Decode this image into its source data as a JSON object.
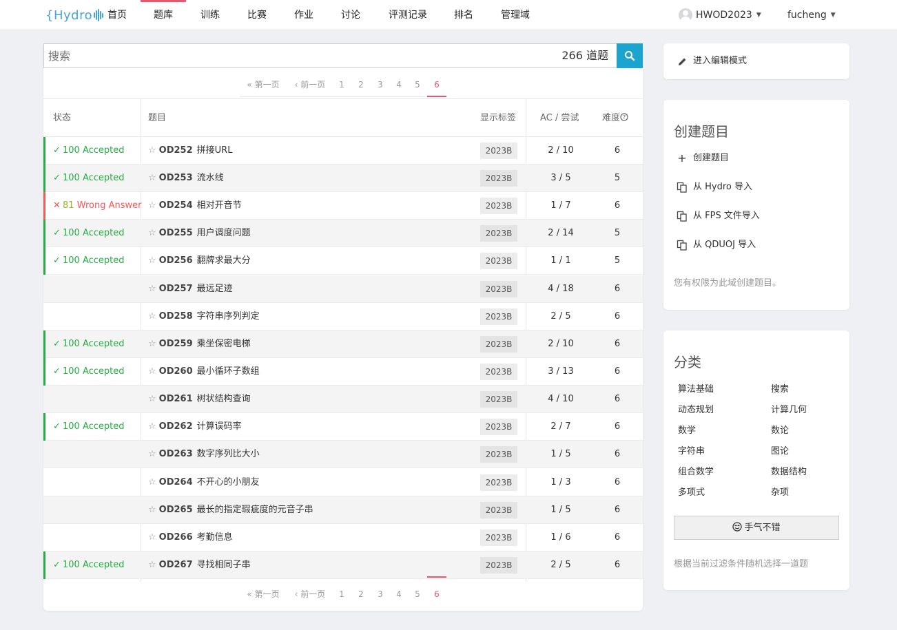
{
  "nav": {
    "logo": "{Hydro",
    "items": [
      "首页",
      "题库",
      "训练",
      "比赛",
      "作业",
      "讨论",
      "评测记录",
      "排名",
      "管理域"
    ],
    "active_index": 1,
    "domain": "HWOD2023",
    "user": "fucheng"
  },
  "search": {
    "placeholder": "搜索",
    "count": "266 道题"
  },
  "pagination": {
    "first": "« 第一页",
    "prev": "‹ 前一页",
    "pages": [
      "1",
      "2",
      "3",
      "4",
      "5",
      "6"
    ],
    "current": "6"
  },
  "table": {
    "headers": {
      "status": "状态",
      "title": "题目",
      "tags": "显示标签",
      "ac": "AC / 尝试",
      "difficulty": "难度"
    },
    "rows": [
      {
        "status": "ac",
        "score": "100",
        "status_text": "Accepted",
        "pid": "OD252",
        "name": "拼接URL",
        "tag": "2023B",
        "ac": "2 / 10",
        "diff": "6"
      },
      {
        "status": "ac",
        "score": "100",
        "status_text": "Accepted",
        "pid": "OD253",
        "name": "流水线",
        "tag": "2023B",
        "ac": "3 / 5",
        "diff": "5"
      },
      {
        "status": "wa",
        "score": "81",
        "status_text": "Wrong Answer",
        "pid": "OD254",
        "name": "相对开音节",
        "tag": "2023B",
        "ac": "1 / 7",
        "diff": "6"
      },
      {
        "status": "ac",
        "score": "100",
        "status_text": "Accepted",
        "pid": "OD255",
        "name": "用户调度问题",
        "tag": "2023B",
        "ac": "2 / 14",
        "diff": "5"
      },
      {
        "status": "ac",
        "score": "100",
        "status_text": "Accepted",
        "pid": "OD256",
        "name": "翻牌求最大分",
        "tag": "2023B",
        "ac": "1 / 1",
        "diff": "5"
      },
      {
        "status": "",
        "score": "",
        "status_text": "",
        "pid": "OD257",
        "name": "最远足迹",
        "tag": "2023B",
        "ac": "4 / 18",
        "diff": "6"
      },
      {
        "status": "",
        "score": "",
        "status_text": "",
        "pid": "OD258",
        "name": "字符串序列判定",
        "tag": "2023B",
        "ac": "2 / 5",
        "diff": "6"
      },
      {
        "status": "ac",
        "score": "100",
        "status_text": "Accepted",
        "pid": "OD259",
        "name": "乘坐保密电梯",
        "tag": "2023B",
        "ac": "2 / 10",
        "diff": "6"
      },
      {
        "status": "ac",
        "score": "100",
        "status_text": "Accepted",
        "pid": "OD260",
        "name": "最小循环子数组",
        "tag": "2023B",
        "ac": "3 / 13",
        "diff": "6"
      },
      {
        "status": "",
        "score": "",
        "status_text": "",
        "pid": "OD261",
        "name": "树状结构查询",
        "tag": "2023B",
        "ac": "4 / 10",
        "diff": "6"
      },
      {
        "status": "ac",
        "score": "100",
        "status_text": "Accepted",
        "pid": "OD262",
        "name": "计算误码率",
        "tag": "2023B",
        "ac": "2 / 7",
        "diff": "6"
      },
      {
        "status": "",
        "score": "",
        "status_text": "",
        "pid": "OD263",
        "name": "数字序列比大小",
        "tag": "2023B",
        "ac": "1 / 5",
        "diff": "6"
      },
      {
        "status": "",
        "score": "",
        "status_text": "",
        "pid": "OD264",
        "name": "不开心的小朋友",
        "tag": "2023B",
        "ac": "1 / 3",
        "diff": "6"
      },
      {
        "status": "",
        "score": "",
        "status_text": "",
        "pid": "OD265",
        "name": "最长的指定瑕疵度的元音子串",
        "tag": "2023B",
        "ac": "1 / 5",
        "diff": "6"
      },
      {
        "status": "",
        "score": "",
        "status_text": "",
        "pid": "OD266",
        "name": "考勤信息",
        "tag": "2023B",
        "ac": "1 / 6",
        "diff": "6"
      },
      {
        "status": "ac",
        "score": "100",
        "status_text": "Accepted",
        "pid": "OD267",
        "name": "寻找相同子串",
        "tag": "2023B",
        "ac": "2 / 5",
        "diff": "6"
      }
    ]
  },
  "sidebar": {
    "edit_mode": "进入编辑模式",
    "create": {
      "heading": "创建题目",
      "links": [
        "创建题目",
        "从 Hydro 导入",
        "从 FPS 文件导入",
        "从 QDUOJ 导入"
      ],
      "note": "您有权限为此域创建题目。"
    },
    "categories": {
      "heading": "分类",
      "items": [
        "算法基础",
        "搜索",
        "动态规划",
        "计算几何",
        "数学",
        "数论",
        "字符串",
        "图论",
        "组合数学",
        "数据结构",
        "多项式",
        "杂项"
      ],
      "lucky_button": "手气不错",
      "lucky_note": "根据当前过滤条件随机选择一道题"
    }
  },
  "colors": {
    "accent": "#e8566f",
    "search_button": "#1ba4cf",
    "accepted": "#25ad40",
    "wrong": "#fb5555",
    "partial_score": "#9ab02d",
    "logo": "#48a3d9"
  }
}
